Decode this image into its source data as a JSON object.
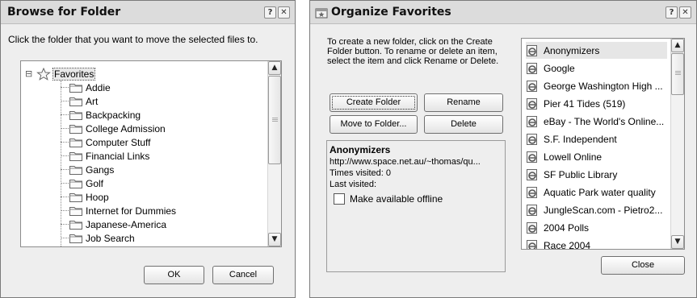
{
  "browse": {
    "title": "Browse for Folder",
    "help_glyph": "?",
    "close_glyph": "✕",
    "instruction": "Click the folder that you want to move the selected files to.",
    "root_label": "Favorites",
    "expander": "⊟",
    "folders": [
      "Addie",
      "Art",
      "Backpacking",
      "College Admission",
      "Computer Stuff",
      "Financial Links",
      "Gangs",
      "Golf",
      "Hoop",
      "Internet for Dummies",
      "Japanese-America",
      "Job Search"
    ],
    "scroll_up": "▲",
    "scroll_down": "▼",
    "ok_label": "OK",
    "cancel_label": "Cancel"
  },
  "organize": {
    "title": "Organize Favorites",
    "help_glyph": "?",
    "close_glyph": "✕",
    "instruction": "To create a new folder, click on the Create Folder button. To rename or delete an item, select the item and click Rename or Delete.",
    "create_folder_label": "Create Folder",
    "rename_label": "Rename",
    "move_label": "Move to Folder...",
    "delete_label": "Delete",
    "info": {
      "name": "Anonymizers",
      "url": "http://www.space.net.au/~thomas/qu...",
      "times_visited": "Times visited: 0",
      "last_visited": "Last visited:",
      "offline_label": "Make available offline"
    },
    "items": [
      "Anonymizers",
      "Google",
      "George Washington High ...",
      "Pier 41 Tides (519)",
      "eBay - The World's Online...",
      "S.F. Independent",
      "Lowell Online",
      "SF Public Library",
      "Aquatic Park water quality",
      "JungleScan.com - Pietro2...",
      "2004 Polls",
      "Race 2004"
    ],
    "scroll_up": "▲",
    "scroll_down": "▼",
    "close_label": "Close"
  }
}
